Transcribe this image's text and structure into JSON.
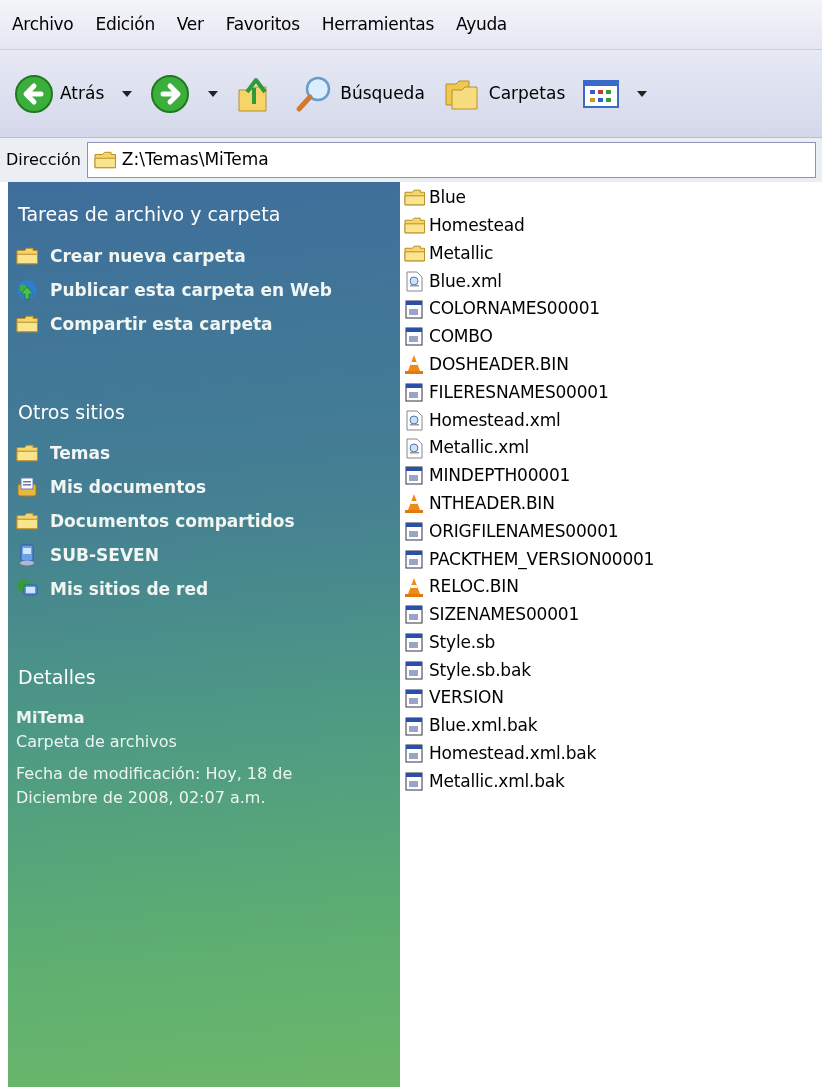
{
  "menu": [
    "Archivo",
    "Edición",
    "Ver",
    "Favoritos",
    "Herramientas",
    "Ayuda"
  ],
  "toolbar": [
    {
      "kind": "back",
      "label": "Atrás"
    },
    {
      "kind": "forward"
    },
    {
      "kind": "up"
    },
    {
      "kind": "search",
      "label": "Búsqueda"
    },
    {
      "kind": "folders",
      "label": "Carpetas"
    },
    {
      "kind": "views"
    }
  ],
  "address": {
    "label": "Dirección",
    "value": "Z:\\Temas\\MiTema"
  },
  "sidebar": [
    {
      "title": "Tareas de archivo y carpeta",
      "items": [
        {
          "kind": "newfolder",
          "label": "Crear nueva carpeta"
        },
        {
          "kind": "publish",
          "label": "Publicar esta carpeta en Web"
        },
        {
          "kind": "share",
          "label": "Compartir esta carpeta"
        }
      ]
    },
    {
      "title": "Otros sitios",
      "items": [
        {
          "kind": "folder",
          "label": "Temas"
        },
        {
          "kind": "docs",
          "label": "Mis documentos"
        },
        {
          "kind": "folder",
          "label": "Documentos compartidos"
        },
        {
          "kind": "computer",
          "label": "SUB-SEVEN"
        },
        {
          "kind": "network",
          "label": "Mis sitios de red"
        }
      ]
    }
  ],
  "details": {
    "title": "Detalles",
    "name": "MiTema",
    "type": "Carpeta de archivos",
    "modified": "Fecha de modificación: Hoy, 18 de Diciembre de 2008, 02:07 a.m."
  },
  "files": [
    {
      "kind": "folder",
      "name": "Blue"
    },
    {
      "kind": "folder",
      "name": "Homestead"
    },
    {
      "kind": "folder",
      "name": "Metallic"
    },
    {
      "kind": "xml",
      "name": "Blue.xml"
    },
    {
      "kind": "app",
      "name": "COLORNAMES00001"
    },
    {
      "kind": "app",
      "name": "COMBO"
    },
    {
      "kind": "cone",
      "name": "DOSHEADER.BIN"
    },
    {
      "kind": "app",
      "name": "FILERESNAMES00001"
    },
    {
      "kind": "xml",
      "name": "Homestead.xml"
    },
    {
      "kind": "xml",
      "name": "Metallic.xml"
    },
    {
      "kind": "app",
      "name": "MINDEPTH00001"
    },
    {
      "kind": "cone",
      "name": "NTHEADER.BIN"
    },
    {
      "kind": "app",
      "name": "ORIGFILENAMES00001"
    },
    {
      "kind": "app",
      "name": "PACKTHEM_VERSION00001"
    },
    {
      "kind": "cone",
      "name": "RELOC.BIN"
    },
    {
      "kind": "app",
      "name": "SIZENAMES00001"
    },
    {
      "kind": "app",
      "name": "Style.sb"
    },
    {
      "kind": "app",
      "name": "Style.sb.bak"
    },
    {
      "kind": "app",
      "name": "VERSION"
    },
    {
      "kind": "app",
      "name": "Blue.xml.bak"
    },
    {
      "kind": "app",
      "name": "Homestead.xml.bak"
    },
    {
      "kind": "app",
      "name": "Metallic.xml.bak"
    }
  ]
}
